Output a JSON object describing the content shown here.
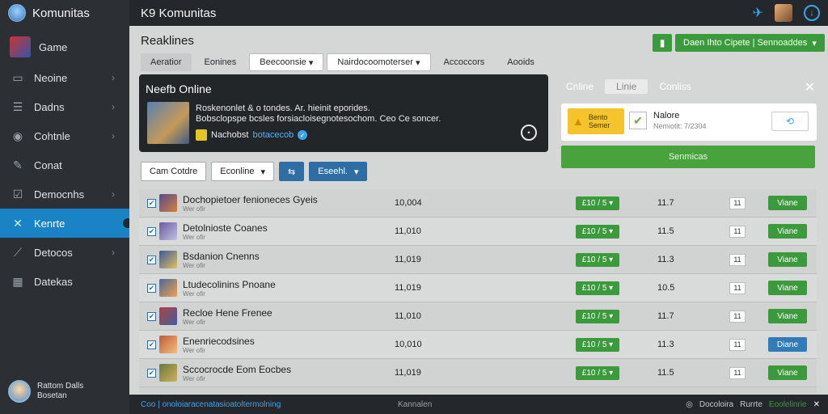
{
  "brand": {
    "name": "Komunitas"
  },
  "header": {
    "title": "K9 Komunitas"
  },
  "sidebar": {
    "items": [
      {
        "label": "Game",
        "icon": "game-icon"
      },
      {
        "label": "Neoine",
        "icon": "image-icon"
      },
      {
        "label": "Dadns",
        "icon": "list-icon"
      },
      {
        "label": "Cohtnle",
        "icon": "chat-icon"
      },
      {
        "label": "Conat",
        "icon": "comment-icon"
      },
      {
        "label": "Democnhs",
        "icon": "check-icon"
      },
      {
        "label": "Kenrte",
        "icon": "grid-icon"
      },
      {
        "label": "Detocos",
        "icon": "edit-icon"
      },
      {
        "label": "Datekas",
        "icon": "table-icon"
      }
    ],
    "user": {
      "line1": "Rattom Dalls",
      "line2": "Bosetan"
    }
  },
  "main": {
    "title": "Reaklines",
    "tabs": [
      "Aeratior",
      "Eonines",
      "Beecoonsie",
      "Nairdocoomoterser",
      "Accoccors",
      "Aooids"
    ],
    "top_button": "Daen Ihto Cipete | Sennoaddes"
  },
  "online": {
    "title": "Neefb Online",
    "desc1": "Roskenonlet & o tondes. Ar. hieinit eporides.",
    "desc2": "Bobsclopspe bcsles forsiacloisegnotesochom. Ceo Ce soncer.",
    "player": "Nachobst",
    "handle": "botacecob"
  },
  "right": {
    "tab1": "Cnline",
    "tab2": "Linie",
    "tab3": "Conliss",
    "warn_line1": "Bento",
    "warn_line2": "Semer",
    "notice_title": "Nalore",
    "notice_sub": "Nemiotit: 7/2304",
    "green_button": "Senmicas"
  },
  "filters": {
    "b1": "Cam Cotdre",
    "b2": "Econline",
    "b3": "Eseehl."
  },
  "rows": [
    {
      "name": "Dochopietoer fenioneces Gyeis",
      "sub": "Wer ofir",
      "count": "10,004",
      "status": "£10 / 5",
      "ver": "11.7",
      "small": "11",
      "action": "Viane"
    },
    {
      "name": "Detolnioste Coanes",
      "sub": "Wer ofir",
      "count": "11,010",
      "status": "£10 / 5",
      "ver": "11.5",
      "small": "11",
      "action": "Viane"
    },
    {
      "name": "Bsdanion Cnenns",
      "sub": "Wer ofir",
      "count": "11,019",
      "status": "£10 / 5",
      "ver": "11.3",
      "small": "11",
      "action": "Viane"
    },
    {
      "name": "Ltudecolinins Pnoane",
      "sub": "Wer ofir",
      "count": "11,019",
      "status": "£10 / 5",
      "ver": "10.5",
      "small": "11",
      "action": "Viane"
    },
    {
      "name": "Recloe Hene Frenee",
      "sub": "Wer ofir",
      "count": "11,010",
      "status": "£10 / 5",
      "ver": "11.7",
      "small": "11",
      "action": "Viane"
    },
    {
      "name": "Enenriecodsines",
      "sub": "Wer ofir",
      "count": "10,010",
      "status": "£10 / 5",
      "ver": "11.3",
      "small": "11",
      "action": "Diane"
    },
    {
      "name": "Sccocrocde Eom Eocbes",
      "sub": "Wer ofir",
      "count": "11,019",
      "status": "£10 / 5",
      "ver": "11.5",
      "small": "11",
      "action": "Viane"
    }
  ],
  "footer": {
    "left": "Coo | onoloiaracenatasioatoltermolning",
    "mid": "Kannalen",
    "right1": "Docoloira",
    "right2": "Rurrte",
    "status": "Eoolelinrie"
  }
}
